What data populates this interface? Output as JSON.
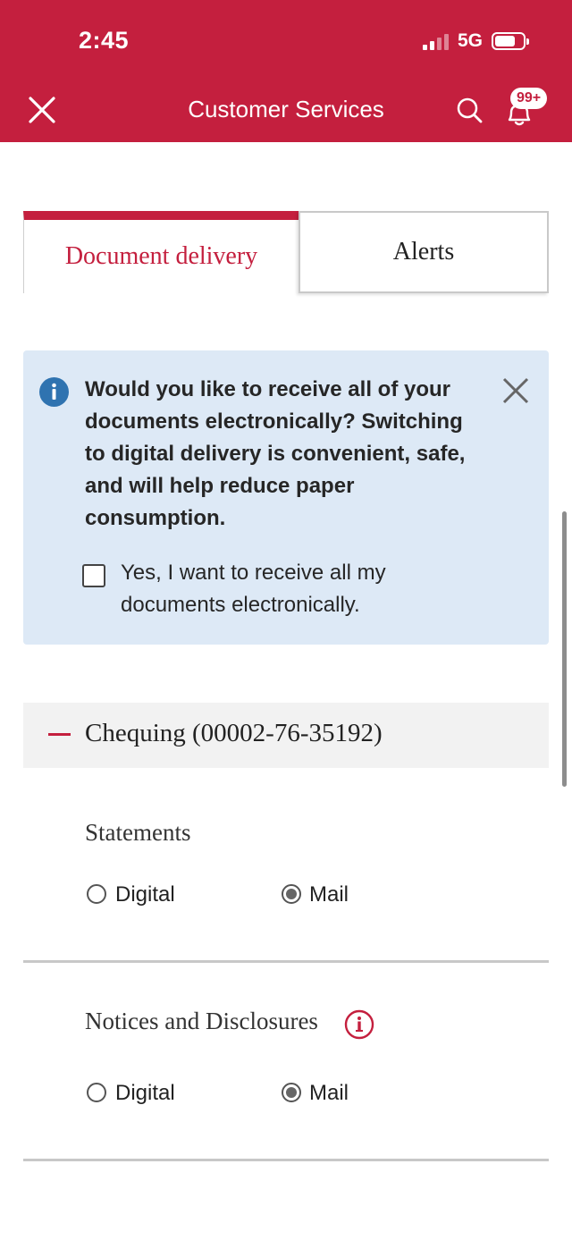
{
  "status_bar": {
    "time": "2:45",
    "network": "5G"
  },
  "header": {
    "title": "Customer Services",
    "notification_badge": "99+",
    "brand_color": "#c41f3e"
  },
  "tabs": [
    {
      "label": "Document delivery",
      "active": true
    },
    {
      "label": "Alerts",
      "active": false
    }
  ],
  "banner": {
    "message": "Would you like to receive all of your documents electronically? Switching to digital delivery is convenient, safe, and will help reduce paper consumption.",
    "checkbox_label": "Yes, I want to receive all my documents electronically.",
    "checked": false,
    "background": "#dde9f6"
  },
  "account": {
    "title": "Chequing (00002-76-35192)",
    "sections": [
      {
        "title": "Statements",
        "options": [
          {
            "label": "Digital",
            "selected": false
          },
          {
            "label": "Mail",
            "selected": true
          }
        ]
      },
      {
        "title": "Notices and Disclosures",
        "options": [
          {
            "label": "Digital",
            "selected": false
          },
          {
            "label": "Mail",
            "selected": true
          }
        ]
      }
    ]
  }
}
